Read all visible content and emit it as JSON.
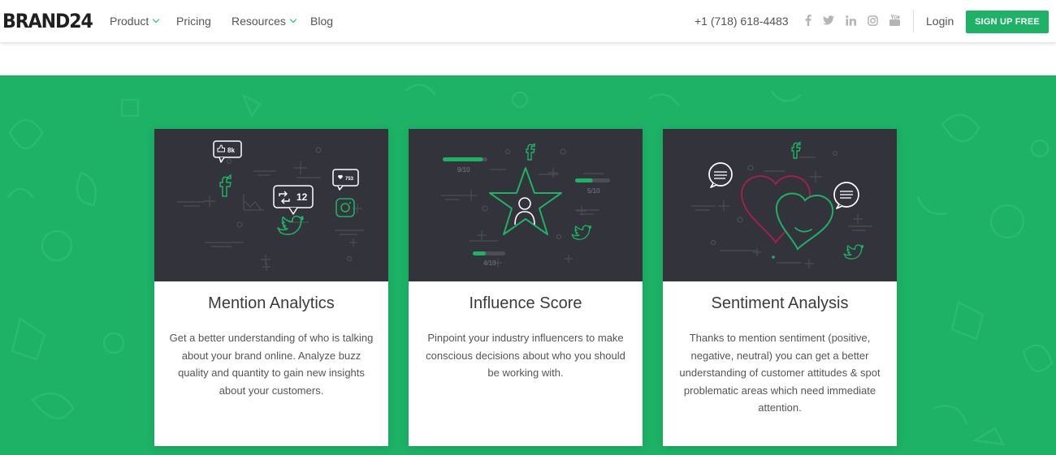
{
  "header": {
    "logo": "BRAND24",
    "nav": [
      {
        "label": "Product",
        "dropdown": true
      },
      {
        "label": "Pricing",
        "dropdown": false
      },
      {
        "label": "Resources",
        "dropdown": true
      },
      {
        "label": "Blog",
        "dropdown": false
      }
    ],
    "phone": "+1 (718) 618-4483",
    "social_icons": [
      "facebook-icon",
      "twitter-icon",
      "linkedin-icon",
      "instagram-icon",
      "youtube-icon"
    ],
    "login": "Login",
    "signup": "SIGN UP FREE"
  },
  "colors": {
    "accent": "#1db266",
    "illustration_bg": "#32333b",
    "heart_red": "#a8204a"
  },
  "features": [
    {
      "title": "Mention Analytics",
      "description": "Get a better understanding of who is talking about your brand online. Analyze buzz quality and quantity to gain new insights about your customers.",
      "illustration": {
        "likes": "8k",
        "retweets": "12",
        "hearts": "753"
      }
    },
    {
      "title": "Influence Score",
      "description": "Pinpoint your industry influencers to make conscious decisions about who you should be working with.",
      "illustration": {
        "scores": [
          "9/10",
          "5/10",
          "4/10"
        ],
        "score_levels": [
          0.9,
          0.5,
          0.4
        ]
      }
    },
    {
      "title": "Sentiment Analysis",
      "description": "Thanks to mention sentiment (positive, negative, neutral) you can get a better understanding of customer attitudes & spot problematic areas which need immediate attention."
    }
  ]
}
